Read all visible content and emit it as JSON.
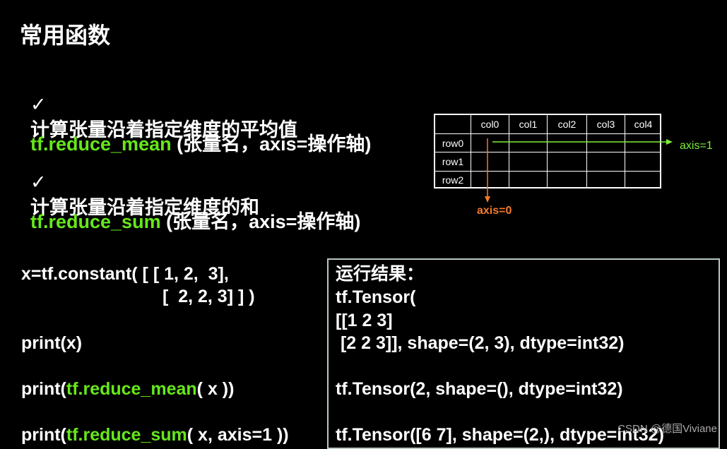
{
  "title": "常用函数",
  "items": [
    {
      "check": "✓",
      "text": "计算张量沿着指定维度的平均值"
    },
    {
      "fn": "tf.reduce_mean",
      "args": " (张量名，axis=操作轴)"
    },
    {
      "check": "✓",
      "text": "计算张量沿着指定维度的和"
    },
    {
      "fn": "tf.reduce_sum",
      "args": " (张量名，axis=操作轴)"
    }
  ],
  "table": {
    "cols": [
      "col0",
      "col1",
      "col2",
      "col3",
      "col4"
    ],
    "rows": [
      "row0",
      "row1",
      "row2"
    ],
    "axis1_label": "axis=1",
    "axis0_label": "axis=0",
    "colors": {
      "axis1": "#7cf03a",
      "axis0": "#f47a2a"
    }
  },
  "code": {
    "line1": "x=tf.constant( [ [ 1, 2,  3],",
    "line2": "[  2, 2, 3] ] )",
    "line3": "print(x)",
    "line4_pre": "print(",
    "line4_fn": "tf.reduce_mean",
    "line4_post": "( x ))",
    "line5_pre": "print(",
    "line5_fn": "tf.reduce_sum",
    "line5_post": "( x, axis=1 ))"
  },
  "result": {
    "header": "运行结果：",
    "line1": "tf.Tensor(",
    "line2": "[[1 2 3]",
    "line3": " [2 2 3]], shape=(2, 3), dtype=int32)",
    "line4": "tf.Tensor(2, shape=(), dtype=int32)",
    "line5": "tf.Tensor([6 7], shape=(2,), dtype=int32)"
  },
  "watermark": "CSDN @德国Viviane",
  "colors": {
    "background": "#000000",
    "highlight": "#66e81a",
    "text": "#ffffff"
  }
}
